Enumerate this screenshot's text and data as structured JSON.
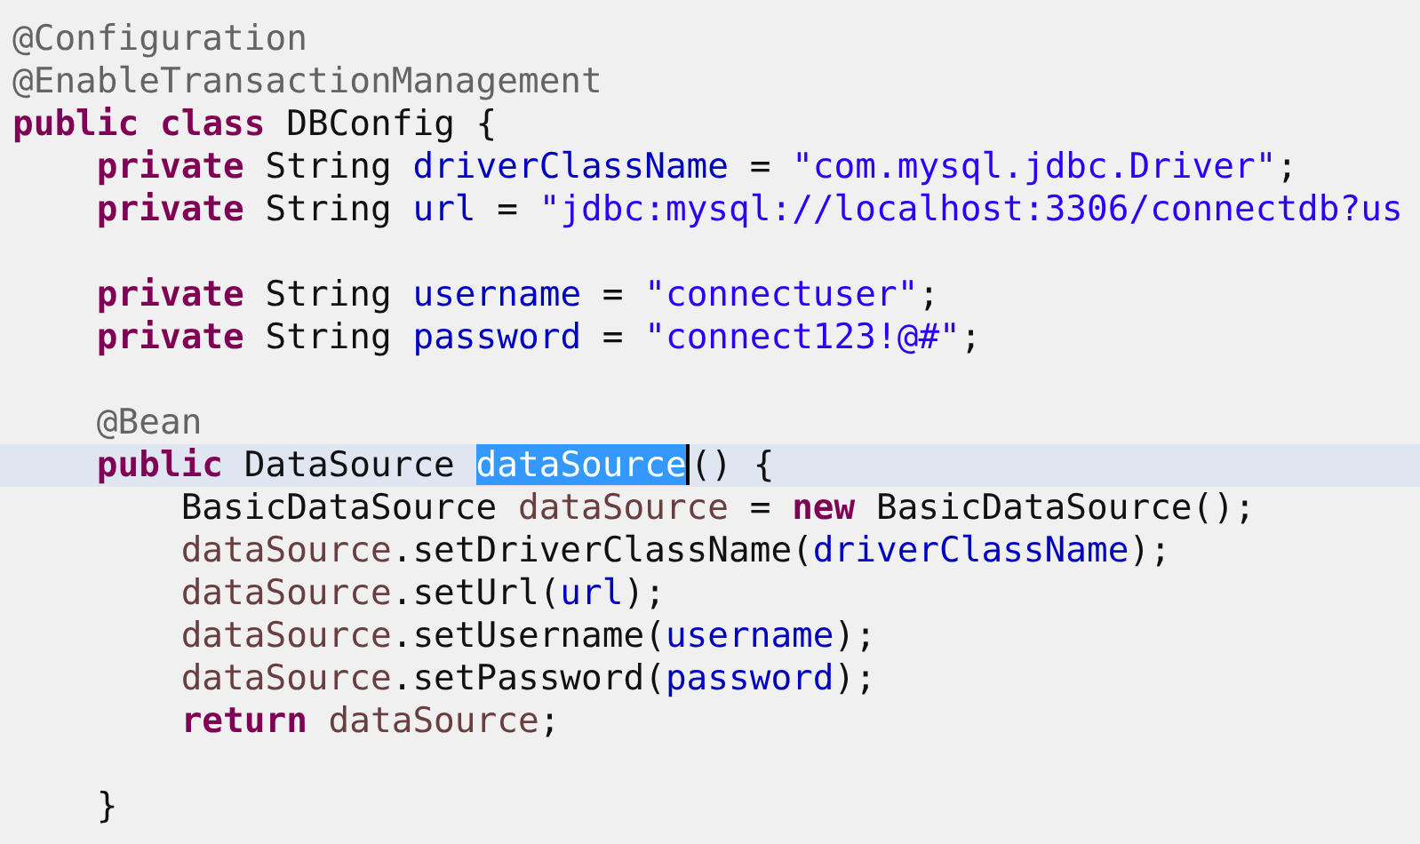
{
  "editor": {
    "lines": [
      {
        "current": false,
        "tokens": [
          {
            "text": "@Configuration",
            "kind": "annotation"
          }
        ]
      },
      {
        "current": false,
        "tokens": [
          {
            "text": "@EnableTransactionManagement",
            "kind": "annotation"
          }
        ]
      },
      {
        "current": false,
        "tokens": [
          {
            "text": "public ",
            "kind": "keyword"
          },
          {
            "text": "class",
            "kind": "keyword"
          },
          {
            "text": " DBConfig {",
            "kind": "plain"
          }
        ],
        "children": [
          {
            "current": false,
            "tokens": [
              {
                "text": "private",
                "kind": "keyword"
              },
              {
                "text": " String ",
                "kind": "plain"
              },
              {
                "text": "driverClassName",
                "kind": "field"
              },
              {
                "text": " = ",
                "kind": "plain"
              },
              {
                "text": "\"com.mysql.jdbc.Driver\"",
                "kind": "string"
              },
              {
                "text": ";",
                "kind": "plain"
              }
            ]
          },
          {
            "current": false,
            "tokens": [
              {
                "text": "private",
                "kind": "keyword"
              },
              {
                "text": " String ",
                "kind": "plain"
              },
              {
                "text": "url",
                "kind": "field"
              },
              {
                "text": " = ",
                "kind": "plain"
              },
              {
                "text": "\"jdbc:mysql://localhost:3306/connectdb?us",
                "kind": "string"
              }
            ]
          },
          {
            "current": false
          },
          {
            "current": false,
            "tokens": [
              {
                "text": "private",
                "kind": "keyword"
              },
              {
                "text": " String ",
                "kind": "plain"
              },
              {
                "text": "username",
                "kind": "field"
              },
              {
                "text": " = ",
                "kind": "plain"
              },
              {
                "text": "\"connectuser\"",
                "kind": "string"
              },
              {
                "text": ";",
                "kind": "plain"
              }
            ]
          },
          {
            "current": false,
            "tokens": [
              {
                "text": "private",
                "kind": "keyword"
              },
              {
                "text": " String ",
                "kind": "plain"
              },
              {
                "text": "password",
                "kind": "field"
              },
              {
                "text": " = ",
                "kind": "plain"
              },
              {
                "text": "\"connect123!@#\"",
                "kind": "string"
              },
              {
                "text": ";",
                "kind": "plain"
              }
            ]
          },
          {
            "current": false
          },
          {
            "current": false,
            "tokens": [
              {
                "text": "@Bean",
                "kind": "annotation"
              }
            ]
          },
          {
            "current": true,
            "tokens": [
              {
                "text": "public",
                "kind": "keyword"
              },
              {
                "text": " DataSource ",
                "kind": "plain"
              },
              {
                "text": "dataSource",
                "kind": "selection"
              },
              {
                "text": "() {",
                "kind": "plain"
              }
            ],
            "children": [
              {
                "current": false,
                "tokens": [
                  {
                    "text": "BasicDataSource ",
                    "kind": "plain"
                  },
                  {
                    "text": "dataSource",
                    "kind": "local"
                  },
                  {
                    "text": " = ",
                    "kind": "plain"
                  },
                  {
                    "text": "new",
                    "kind": "keyword"
                  },
                  {
                    "text": " BasicDataSource();",
                    "kind": "plain"
                  }
                ]
              },
              {
                "current": false,
                "tokens": [
                  {
                    "text": "dataSource",
                    "kind": "local"
                  },
                  {
                    "text": ".setDriverClassName(",
                    "kind": "plain"
                  },
                  {
                    "text": "driverClassName",
                    "kind": "field"
                  },
                  {
                    "text": ");",
                    "kind": "plain"
                  }
                ]
              },
              {
                "current": false,
                "tokens": [
                  {
                    "text": "dataSource",
                    "kind": "local"
                  },
                  {
                    "text": ".setUrl(",
                    "kind": "plain"
                  },
                  {
                    "text": "url",
                    "kind": "field"
                  },
                  {
                    "text": ");",
                    "kind": "plain"
                  }
                ]
              },
              {
                "current": false,
                "tokens": [
                  {
                    "text": "dataSource",
                    "kind": "local"
                  },
                  {
                    "text": ".setUsername(",
                    "kind": "plain"
                  },
                  {
                    "text": "username",
                    "kind": "field"
                  },
                  {
                    "text": ");",
                    "kind": "plain"
                  }
                ]
              },
              {
                "current": false,
                "tokens": [
                  {
                    "text": "dataSource",
                    "kind": "local"
                  },
                  {
                    "text": ".setPassword(",
                    "kind": "plain"
                  },
                  {
                    "text": "password",
                    "kind": "field"
                  },
                  {
                    "text": ");",
                    "kind": "plain"
                  }
                ]
              },
              {
                "current": false,
                "tokens": [
                  {
                    "text": "return ",
                    "kind": "keyword"
                  },
                  {
                    "text": "dataSource",
                    "kind": "local"
                  },
                  {
                    "text": ";",
                    "kind": "plain"
                  }
                ]
              },
              {
                "current": false
              }
            ]
          },
          {
            "current": false,
            "tokens": [
              {
                "text": "}",
                "kind": "plain"
              }
            ]
          }
        ]
      }
    ]
  }
}
